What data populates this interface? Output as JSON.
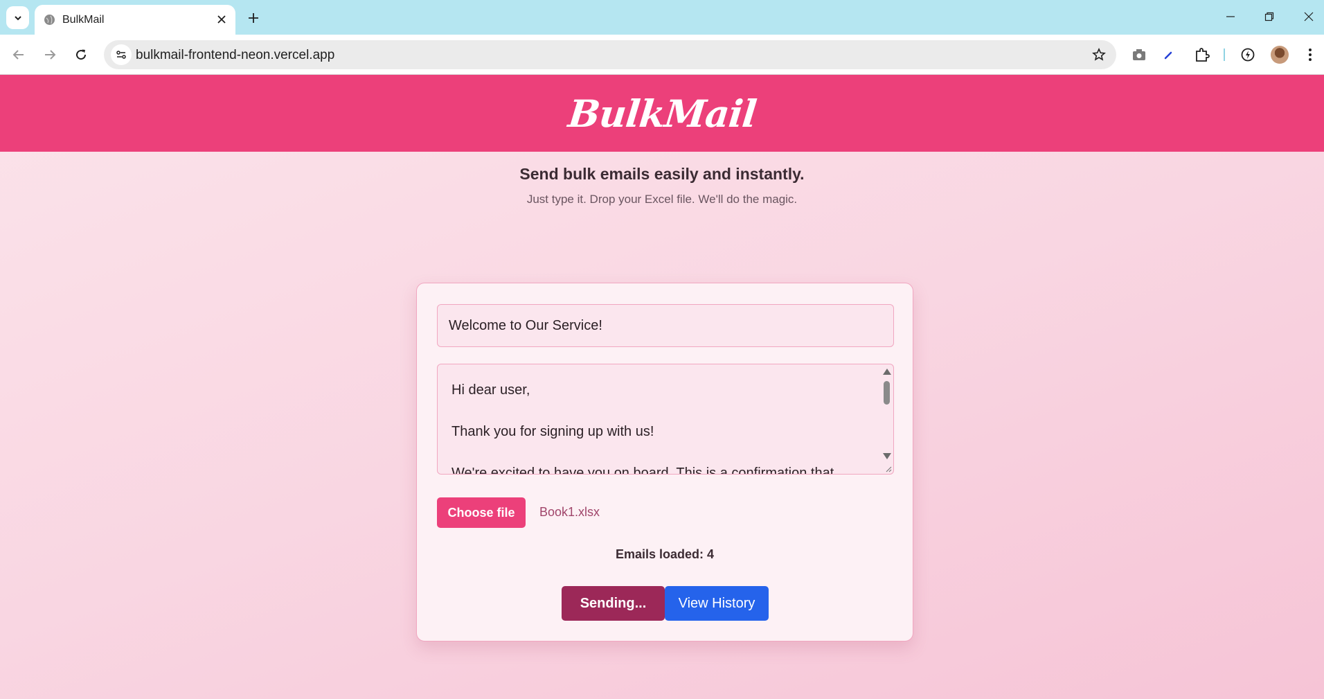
{
  "browser": {
    "tab_title": "BulkMail",
    "url": "bulkmail-frontend-neon.vercel.app"
  },
  "app": {
    "logo": "BulkMail",
    "tagline": "Send bulk emails easily and instantly.",
    "subtagline": "Just type it. Drop your Excel file. We'll do the magic."
  },
  "form": {
    "subject_value": "Welcome to Our Service!",
    "body_value": "Hi dear user,\n\nThank you for signing up with us!\n\nWe're excited to have you on board. This is a confirmation that",
    "choose_file_label": "Choose file",
    "file_name": "Book1.xlsx",
    "emails_loaded": "Emails loaded: 4",
    "send_label": "Sending...",
    "history_label": "View History"
  },
  "colors": {
    "brand": "#ec407a",
    "sending": "#9c2858",
    "history": "#2563eb"
  }
}
